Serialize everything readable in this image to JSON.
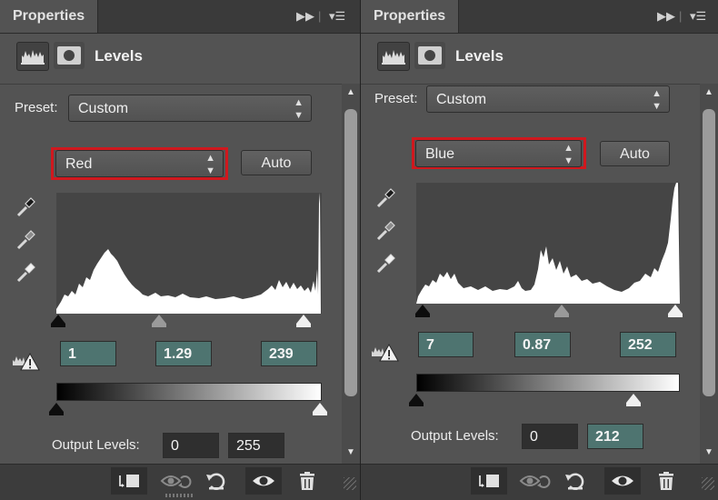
{
  "panels": [
    {
      "tab_title": "Properties",
      "adjustment_title": "Levels",
      "preset_label": "Preset:",
      "preset_value": "Custom",
      "channel_value": "Red",
      "auto_label": "Auto",
      "input_black": "1",
      "input_gamma": "1.29",
      "input_white": "239",
      "output_label": "Output Levels:",
      "output_black": "0",
      "output_white": "255",
      "input_black_fraction": 0.0,
      "input_gamma_fraction": 0.39,
      "input_white_fraction": 0.94,
      "output_black_fraction": 0.0,
      "output_white_fraction": 1.0
    },
    {
      "tab_title": "Properties",
      "adjustment_title": "Levels",
      "preset_label": "Preset:",
      "preset_value": "Custom",
      "channel_value": "Blue",
      "auto_label": "Auto",
      "input_black": "7",
      "input_gamma": "0.87",
      "input_white": "252",
      "output_label": "Output Levels:",
      "output_black": "0",
      "output_white": "212",
      "input_black_fraction": 0.0,
      "input_gamma_fraction": 0.55,
      "input_white_fraction": 1.0,
      "output_black_fraction": 0.0,
      "output_white_fraction": 0.83
    }
  ],
  "icons": {
    "tab_expand": "double-arrow-icon",
    "tab_menu": "panel-menu-icon",
    "levels": "levels-histogram-icon",
    "mask": "layer-mask-icon",
    "dropper_black": "black-eyedropper-icon",
    "dropper_gray": "gray-eyedropper-icon",
    "dropper_white": "white-eyedropper-icon",
    "clip_warning": "clipping-warning-icon",
    "clip_to_layer": "clip-to-layer-icon",
    "view_previous": "view-previous-state-icon",
    "reset": "reset-icon",
    "visibility": "eye-icon",
    "delete": "trash-icon"
  },
  "colors": {
    "panel_bg": "#535353",
    "highlight": "#d0181e",
    "field_active": "#4e7470"
  }
}
